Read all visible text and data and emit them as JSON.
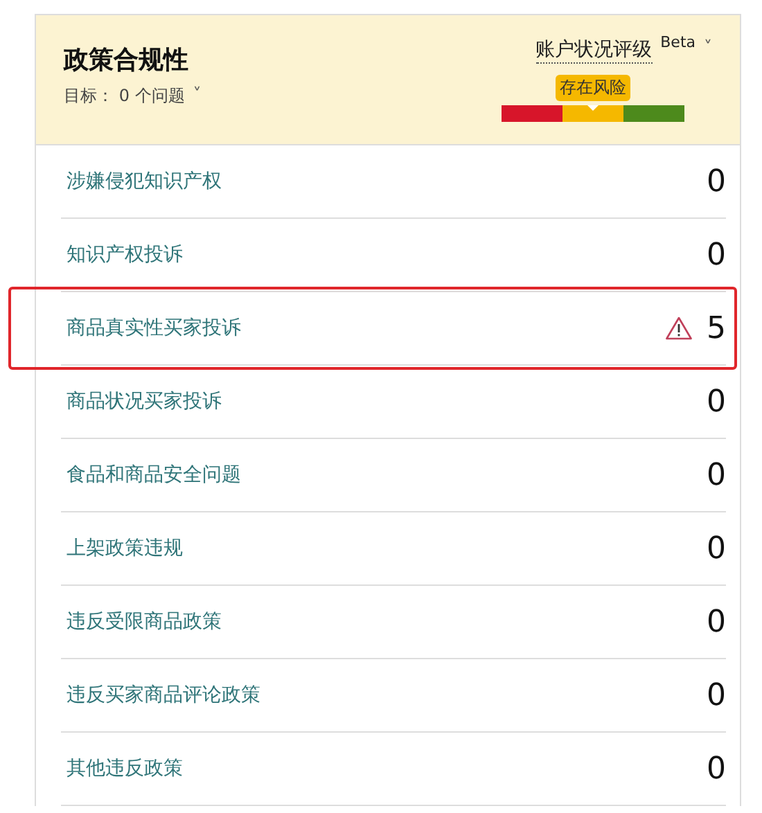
{
  "header": {
    "title": "政策合规性",
    "target": "目标： 0 个问题",
    "target_caret": "˅",
    "rating": {
      "label": "账户状况评级",
      "badge": "Beta",
      "caret": "˅",
      "status": "存在风险",
      "segments": [
        {
          "color": "#d7152a",
          "selected": false
        },
        {
          "color": "#f5b800",
          "selected": true
        },
        {
          "color": "#4d8a1c",
          "selected": false
        }
      ]
    }
  },
  "rows": [
    {
      "label": "涉嫌侵犯知识产权",
      "count": "0",
      "highlighted": false,
      "warning": false
    },
    {
      "label": "知识产权投诉",
      "count": "0",
      "highlighted": false,
      "warning": false
    },
    {
      "label": "商品真实性买家投诉",
      "count": "5",
      "highlighted": true,
      "warning": true
    },
    {
      "label": "商品状况买家投诉",
      "count": "0",
      "highlighted": false,
      "warning": false
    },
    {
      "label": "食品和商品安全问题",
      "count": "0",
      "highlighted": false,
      "warning": false
    },
    {
      "label": "上架政策违规",
      "count": "0",
      "highlighted": false,
      "warning": false
    },
    {
      "label": "违反受限商品政策",
      "count": "0",
      "highlighted": false,
      "warning": false
    },
    {
      "label": "违反买家商品评论政策",
      "count": "0",
      "highlighted": false,
      "warning": false
    },
    {
      "label": "其他违反政策",
      "count": "0",
      "highlighted": false,
      "warning": false
    }
  ]
}
